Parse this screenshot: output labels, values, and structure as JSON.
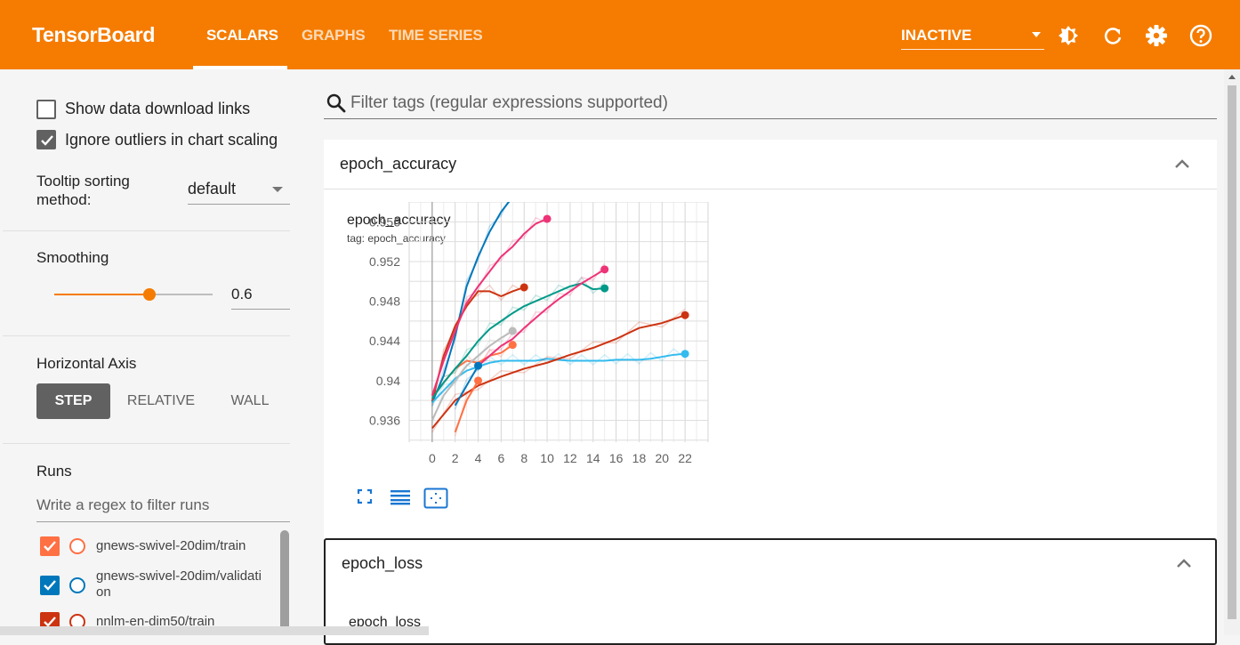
{
  "app": {
    "brand": "TensorBoard",
    "tabs": [
      {
        "label": "SCALARS",
        "active": true
      },
      {
        "label": "GRAPHS",
        "active": false
      },
      {
        "label": "TIME SERIES",
        "active": false
      }
    ],
    "run_status": "INACTIVE",
    "icons": [
      "brightness-icon",
      "refresh-icon",
      "settings-icon",
      "help-icon"
    ],
    "colors": {
      "accent": "#f57c00",
      "header_text": "#ffffff"
    }
  },
  "sidebar": {
    "show_download_links": {
      "label": "Show data download links",
      "checked": false
    },
    "ignore_outliers": {
      "label": "Ignore outliers in chart scaling",
      "checked": true
    },
    "tooltip_sorting": {
      "label_line1": "Tooltip sorting",
      "label_line2": "method:",
      "value": "default"
    },
    "smoothing": {
      "label": "Smoothing",
      "value": "0.6",
      "fraction": 0.6
    },
    "horizontal_axis": {
      "label": "Horizontal Axis",
      "options": [
        "STEP",
        "RELATIVE",
        "WALL"
      ],
      "selected": "STEP"
    },
    "runs": {
      "label": "Runs",
      "filter_placeholder": "Write a regex to filter runs",
      "items": [
        {
          "name": "gnews-swivel-20dim/train",
          "color": "#ff7043",
          "checked": true
        },
        {
          "name": "gnews-swivel-20dim/validation",
          "name_line1": "gnews-swivel-20dim/validati",
          "name_line2": "on",
          "color": "#0077bb",
          "checked": true
        },
        {
          "name": "nnlm-en-dim50/train",
          "color": "#cc3311",
          "checked": true
        }
      ]
    }
  },
  "main": {
    "filter_placeholder": "Filter tags (regular expressions supported)",
    "cards": [
      {
        "title": "epoch_accuracy",
        "chart_title": "epoch_accuracy",
        "chart_tag": "tag: epoch_accuracy",
        "buttons": [
          "fullscreen-icon",
          "data-list-icon",
          "fit-domain-icon"
        ]
      },
      {
        "title": "epoch_loss",
        "chart_title": "epoch_loss"
      }
    ]
  },
  "chart_data": {
    "type": "line",
    "title": "epoch_accuracy",
    "subtitle": "tag: epoch_accuracy",
    "xlabel": "",
    "ylabel": "",
    "x_ticks": [
      0,
      2,
      4,
      6,
      8,
      10,
      12,
      14,
      16,
      18,
      20,
      22
    ],
    "y_ticks": [
      "0.936",
      "0.94",
      "0.944",
      "0.948",
      "0.952",
      "0.956"
    ],
    "xlim": [
      -2,
      24
    ],
    "ylim": [
      0.9338,
      0.958
    ],
    "grid": true,
    "series": [
      {
        "color": "#ff7043",
        "x": [
          0,
          1,
          2,
          3,
          4,
          5,
          6,
          7
        ],
        "y": [
          0.9384,
          0.9398,
          0.9412,
          0.942,
          0.9418,
          0.9425,
          0.9428,
          0.9436
        ]
      },
      {
        "color": "#0077bb",
        "x": [
          0,
          1,
          2,
          3,
          4,
          5,
          6,
          7
        ],
        "y": [
          0.9378,
          0.9405,
          0.9445,
          0.9495,
          0.9525,
          0.955,
          0.957,
          0.9585
        ]
      },
      {
        "color": "#cc3311",
        "x": [
          0,
          1,
          2,
          3,
          4,
          5,
          6,
          7,
          8
        ],
        "y": [
          0.9379,
          0.9425,
          0.9455,
          0.9475,
          0.949,
          0.949,
          0.9485,
          0.949,
          0.9494
        ]
      },
      {
        "color": "#33bbee",
        "x": [
          0,
          1,
          2,
          3,
          4,
          5,
          6,
          7,
          8,
          9,
          10,
          11,
          12,
          13,
          14,
          15,
          16,
          17,
          18,
          19,
          20,
          21,
          22
        ],
        "y": [
          0.9378,
          0.939,
          0.9402,
          0.941,
          0.9414,
          0.9418,
          0.942,
          0.942,
          0.942,
          0.942,
          0.9422,
          0.9421,
          0.942,
          0.942,
          0.942,
          0.942,
          0.9421,
          0.9421,
          0.9421,
          0.9422,
          0.9424,
          0.9426,
          0.9427
        ]
      },
      {
        "color": "#ee3377",
        "x": [
          0,
          1,
          2,
          3,
          4,
          5,
          6,
          7,
          8,
          9,
          10
        ],
        "y": [
          0.9385,
          0.942,
          0.945,
          0.9478,
          0.9495,
          0.951,
          0.9525,
          0.9535,
          0.9548,
          0.9558,
          0.9563
        ]
      },
      {
        "color": "#009988",
        "x": [
          0,
          1,
          2,
          3,
          4,
          5,
          6,
          7,
          8,
          9,
          10,
          11,
          12,
          13,
          14,
          15
        ],
        "y": [
          0.9382,
          0.9398,
          0.9412,
          0.9425,
          0.944,
          0.9452,
          0.946,
          0.9468,
          0.9475,
          0.948,
          0.9485,
          0.949,
          0.9495,
          0.9498,
          0.9492,
          0.9493
        ]
      },
      {
        "color": "#ee3377",
        "x": [
          4,
          5,
          6,
          7,
          8,
          9,
          10,
          11,
          12,
          13,
          14,
          15
        ],
        "y": [
          0.9415,
          0.9425,
          0.9435,
          0.9442,
          0.9453,
          0.9463,
          0.9473,
          0.9482,
          0.949,
          0.9498,
          0.9505,
          0.9512
        ]
      },
      {
        "color": "#cc3311",
        "x": [
          0,
          2,
          4,
          6,
          8,
          10,
          12,
          14,
          16,
          18,
          20,
          22
        ],
        "y": [
          0.9352,
          0.938,
          0.9395,
          0.9404,
          0.9412,
          0.9418,
          0.9426,
          0.9433,
          0.9442,
          0.9453,
          0.9458,
          0.9466
        ]
      },
      {
        "color": "#bbbbbb",
        "x": [
          0,
          1,
          2,
          3,
          4,
          5,
          6,
          7
        ],
        "y": [
          0.936,
          0.9385,
          0.94,
          0.9415,
          0.9425,
          0.9435,
          0.9443,
          0.945
        ]
      },
      {
        "color": "#0077bb",
        "x": [
          2,
          3,
          4
        ],
        "y": [
          0.9375,
          0.9395,
          0.9415
        ]
      },
      {
        "color": "#ff7043",
        "x": [
          2,
          3,
          4
        ],
        "y": [
          0.9348,
          0.938,
          0.94
        ]
      }
    ]
  }
}
